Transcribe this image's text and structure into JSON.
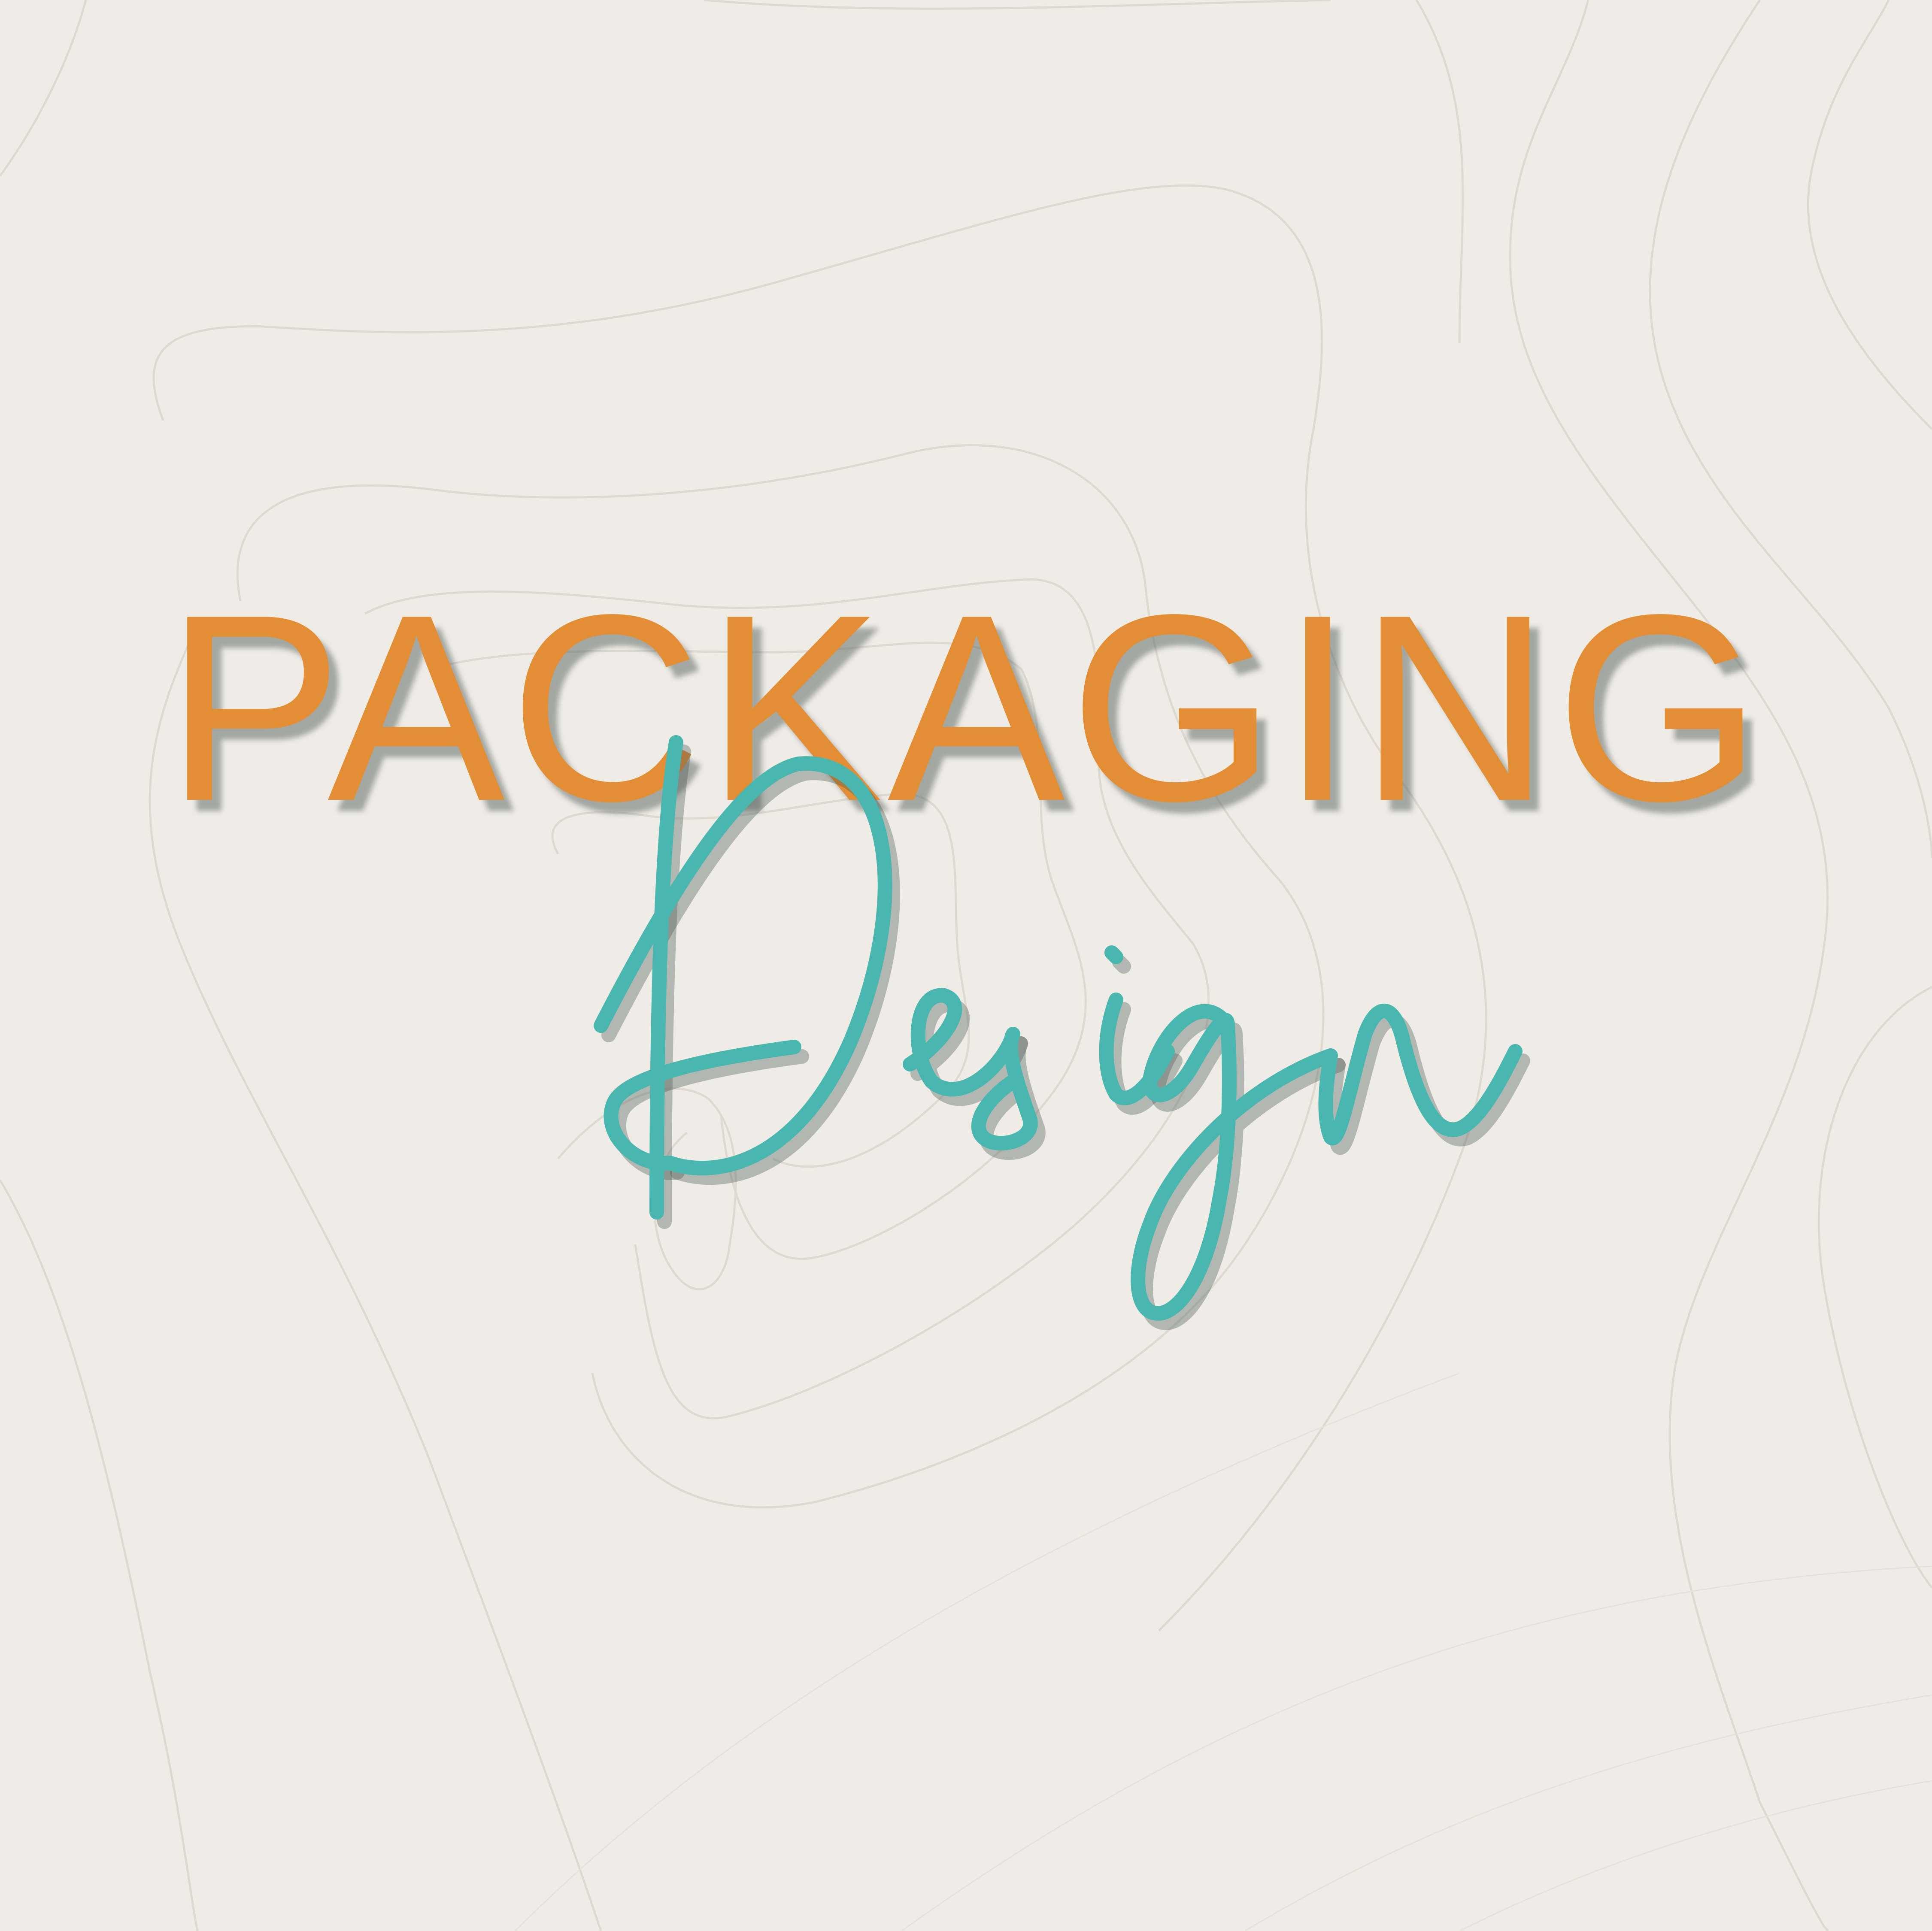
{
  "headline": "PACKAGING",
  "script_word": "Design",
  "colors": {
    "background": "#efece5",
    "contour_lines": "#dedad2",
    "headline": "#e38e35",
    "script": "#4ab6b0"
  }
}
